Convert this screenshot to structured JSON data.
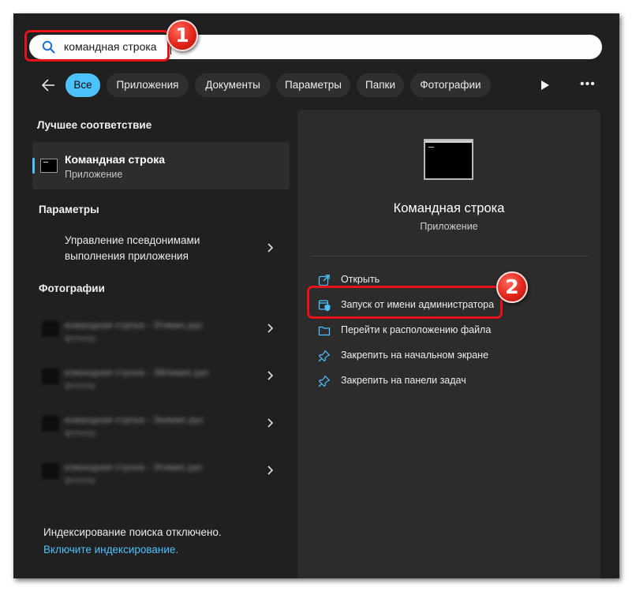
{
  "search": {
    "query": "командная строка"
  },
  "annotations": {
    "step1": "1",
    "step2": "2"
  },
  "filters": [
    "Все",
    "Приложения",
    "Документы",
    "Параметры",
    "Папки",
    "Фотографии"
  ],
  "left": {
    "best_match_title": "Лучшее соответствие",
    "best_match": {
      "name": "Командная строка",
      "type": "Приложение"
    },
    "settings_title": "Параметры",
    "settings_item": "Управление псевдонимами выполнения приложения",
    "photos_title": "Фотографии",
    "photo_items": [
      {
        "name": "командная строка",
        "path": "- Этимис.рус",
        "sub": "фтmosty"
      },
      {
        "name": "командная строка",
        "path": "- Эйлимис.рус",
        "sub": "фтmosty"
      },
      {
        "name": "командная строка",
        "path": "- Экиммс.рус",
        "sub": "фтmosty"
      },
      {
        "name": "командная строка",
        "path": "- Этимис.рус",
        "sub": "фтmosty"
      }
    ],
    "status": "Индексирование поиска отключено.",
    "status_link": "Включите индексирование."
  },
  "right": {
    "app_name": "Командная строка",
    "app_type": "Приложение",
    "actions": [
      {
        "label": "Открыть",
        "icon": "open-external-icon"
      },
      {
        "label": "Запуск от имени администратора",
        "icon": "admin-shield-icon"
      },
      {
        "label": "Перейти к расположению файла",
        "icon": "folder-icon"
      },
      {
        "label": "Закрепить на начальном экране",
        "icon": "pin-icon"
      },
      {
        "label": "Закрепить на панели задач",
        "icon": "pin-icon"
      }
    ]
  },
  "colors": {
    "accent": "#4cc2ff",
    "highlight": "#e8121a",
    "background": "#202020",
    "panel": "#2c2c2c"
  }
}
